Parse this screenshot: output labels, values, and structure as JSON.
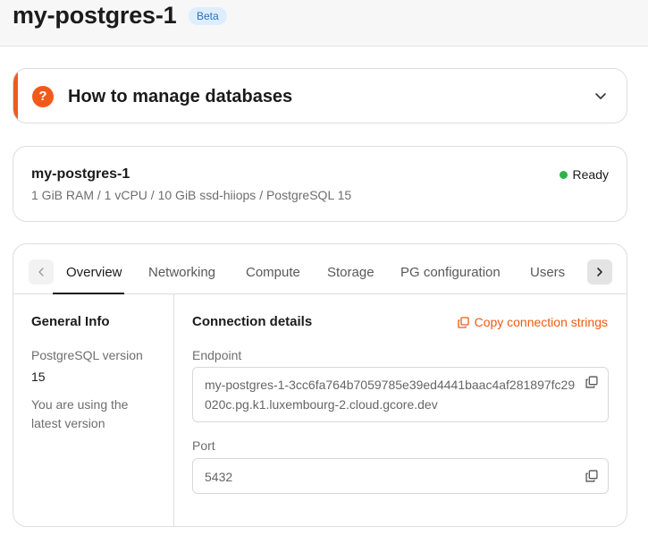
{
  "header": {
    "title": "my-postgres-1",
    "badge": "Beta"
  },
  "help": {
    "icon_glyph": "?",
    "title": "How to manage databases",
    "accent_color": "#f25a1c"
  },
  "instance": {
    "name": "my-postgres-1",
    "specs": "1 GiB RAM / 1 vCPU / 10 GiB ssd-hiiops / PostgreSQL 15",
    "status": "Ready",
    "status_color": "#2bb34b"
  },
  "tabs": {
    "items": [
      "Overview",
      "Networking",
      "Compute",
      "Storage",
      "PG configuration",
      "Users"
    ],
    "active": "Overview"
  },
  "general_info": {
    "heading": "General Info",
    "version_label": "PostgreSQL version",
    "version_value": "15",
    "note": "You are using the latest version"
  },
  "connection": {
    "heading": "Connection details",
    "copy_label": "Copy connection strings",
    "endpoint_label": "Endpoint",
    "endpoint_value": "my-postgres-1-3cc6fa764b7059785e39ed4441baac4af281897fc29020c.pg.k1.luxembourg-2.cloud.gcore.dev",
    "port_label": "Port",
    "port_value": "5432"
  },
  "icons": {
    "help": "help-circle-icon",
    "expand": "chevron-down-icon",
    "copy": "copy-icon",
    "scroll_left": "chevron-left-icon",
    "scroll_right": "chevron-right-icon",
    "status": "status-dot-icon"
  }
}
